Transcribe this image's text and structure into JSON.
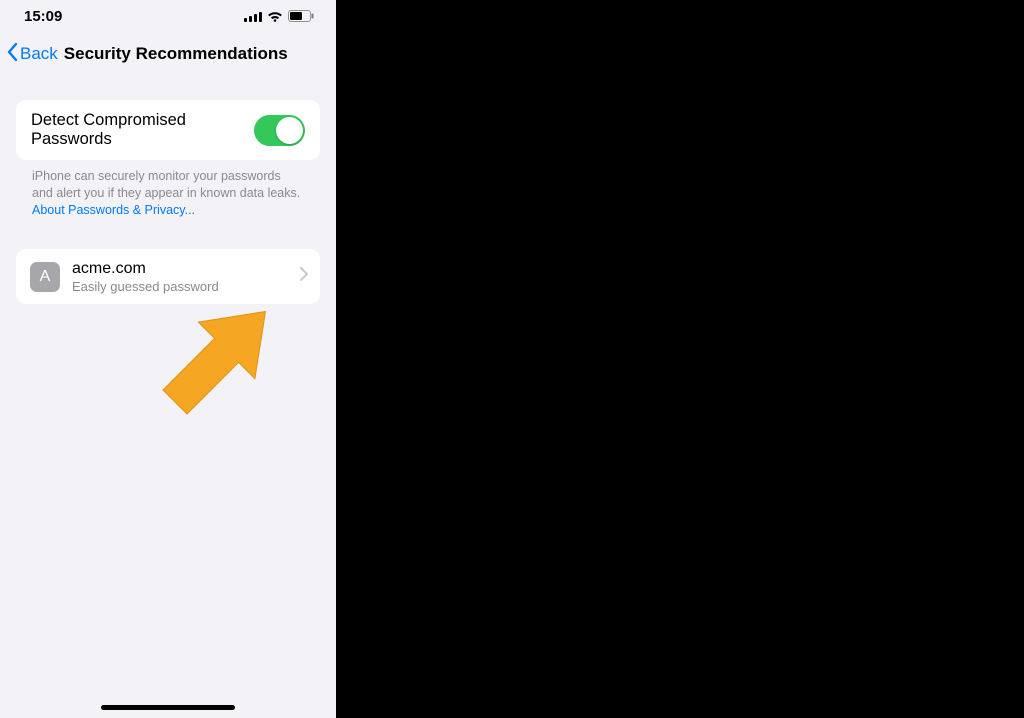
{
  "status": {
    "time": "15:09"
  },
  "nav": {
    "back_label": "Back",
    "title": "Security Recommendations"
  },
  "toggle": {
    "label": "Detect Compromised Passwords",
    "on": true
  },
  "footer": {
    "text": "iPhone can securely monitor your passwords and alert you if they appear in known data leaks. ",
    "link": "About Passwords & Privacy..."
  },
  "items": [
    {
      "avatar_letter": "A",
      "title": "acme.com",
      "subtitle": "Easily guessed password"
    }
  ],
  "colors": {
    "accent": "#007aff",
    "switch_on": "#34c759",
    "bg": "#f2f2f7",
    "arrow": "#f5a623"
  }
}
